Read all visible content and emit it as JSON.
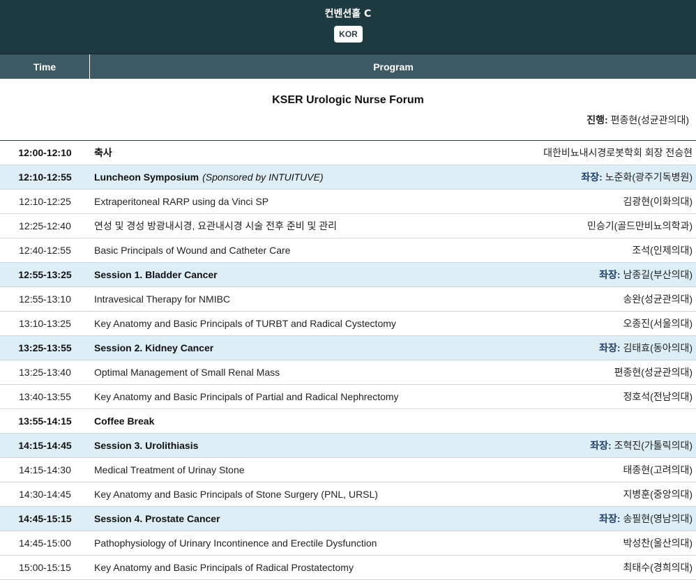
{
  "hall": {
    "title": "컨벤션홀 C",
    "lang_label": "KOR"
  },
  "columns": {
    "time": "Time",
    "program": "Program"
  },
  "forum": {
    "title": "KSER Urologic Nurse Forum",
    "moderator_label": "진행:",
    "moderator_name": "편종현(성균관의대)"
  },
  "colors": {
    "header_bg": "#1d3a40",
    "column_header_bg": "#3c5a63",
    "session_row_bg": "#deeef7",
    "chair_label": "#1f3f6b"
  },
  "schedule": [
    {
      "time": "12:00-12:10",
      "title": "축사",
      "sponsor": "",
      "chair_label": "",
      "speaker": "대한비뇨내시경로봇학회 회장 전승현",
      "session": false,
      "bold": true
    },
    {
      "time": "12:10-12:55",
      "title": "Luncheon Symposium",
      "sponsor": "(Sponsored by INTUITUVE)",
      "chair_label": "좌장:",
      "speaker": "노준화(광주기독병원)",
      "session": true,
      "bold": true
    },
    {
      "time": "12:10-12:25",
      "title": "Extraperitoneal RARP using da Vinci SP",
      "sponsor": "",
      "chair_label": "",
      "speaker": "김광현(이화의대)",
      "session": false,
      "bold": false
    },
    {
      "time": "12:25-12:40",
      "title": "연성 및 경성 방광내시경, 요관내시경 시술 전후 준비 및 관리",
      "sponsor": "",
      "chair_label": "",
      "speaker": "민승기(골드만비뇨의학과)",
      "session": false,
      "bold": false
    },
    {
      "time": "12:40-12:55",
      "title": "Basic Principals of Wound and Catheter Care",
      "sponsor": "",
      "chair_label": "",
      "speaker": "조석(인제의대)",
      "session": false,
      "bold": false
    },
    {
      "time": "12:55-13:25",
      "title": "Session 1. Bladder Cancer",
      "sponsor": "",
      "chair_label": "좌장:",
      "speaker": "남종길(부산의대)",
      "session": true,
      "bold": true
    },
    {
      "time": "12:55-13:10",
      "title": "Intravesical Therapy for NMIBC",
      "sponsor": "",
      "chair_label": "",
      "speaker": "송완(성균관의대)",
      "session": false,
      "bold": false
    },
    {
      "time": "13:10-13:25",
      "title": "Key Anatomy and Basic Principals of TURBT and Radical Cystectomy",
      "sponsor": "",
      "chair_label": "",
      "speaker": "오종진(서울의대)",
      "session": false,
      "bold": false
    },
    {
      "time": "13:25-13:55",
      "title": "Session 2. Kidney Cancer",
      "sponsor": "",
      "chair_label": "좌장:",
      "speaker": "김태효(동아의대)",
      "session": true,
      "bold": true
    },
    {
      "time": "13:25-13:40",
      "title": "Optimal Management of Small Renal Mass",
      "sponsor": "",
      "chair_label": "",
      "speaker": "편종현(성균관의대)",
      "session": false,
      "bold": false
    },
    {
      "time": "13:40-13:55",
      "title": "Key Anatomy and Basic Principals of Partial and Radical Nephrectomy",
      "sponsor": "",
      "chair_label": "",
      "speaker": "정호석(전남의대)",
      "session": false,
      "bold": false
    },
    {
      "time": "13:55-14:15",
      "title": "Coffee Break",
      "sponsor": "",
      "chair_label": "",
      "speaker": "",
      "session": false,
      "bold": true
    },
    {
      "time": "14:15-14:45",
      "title": "Session 3. Urolithiasis",
      "sponsor": "",
      "chair_label": "좌장:",
      "speaker": "조혁진(가톨릭의대)",
      "session": true,
      "bold": true
    },
    {
      "time": "14:15-14:30",
      "title": "Medical Treatment of Urinay Stone",
      "sponsor": "",
      "chair_label": "",
      "speaker": "태종현(고려의대)",
      "session": false,
      "bold": false
    },
    {
      "time": "14:30-14:45",
      "title": "Key Anatomy and Basic Principals of Stone Surgery (PNL, URSL)",
      "sponsor": "",
      "chair_label": "",
      "speaker": "지병훈(중앙의대)",
      "session": false,
      "bold": false
    },
    {
      "time": "14:45-15:15",
      "title": "Session 4. Prostate Cancer",
      "sponsor": "",
      "chair_label": "좌장:",
      "speaker": "송필현(영남의대)",
      "session": true,
      "bold": true
    },
    {
      "time": "14:45-15:00",
      "title": "Pathophysiology of Urinary Incontinence and Erectile Dysfunction",
      "sponsor": "",
      "chair_label": "",
      "speaker": "박성찬(울산의대)",
      "session": false,
      "bold": false
    },
    {
      "time": "15:00-15:15",
      "title": "Key Anatomy and Basic Principals of Radical Prostatectomy",
      "sponsor": "",
      "chair_label": "",
      "speaker": "최태수(경희의대)",
      "session": false,
      "bold": false
    }
  ]
}
